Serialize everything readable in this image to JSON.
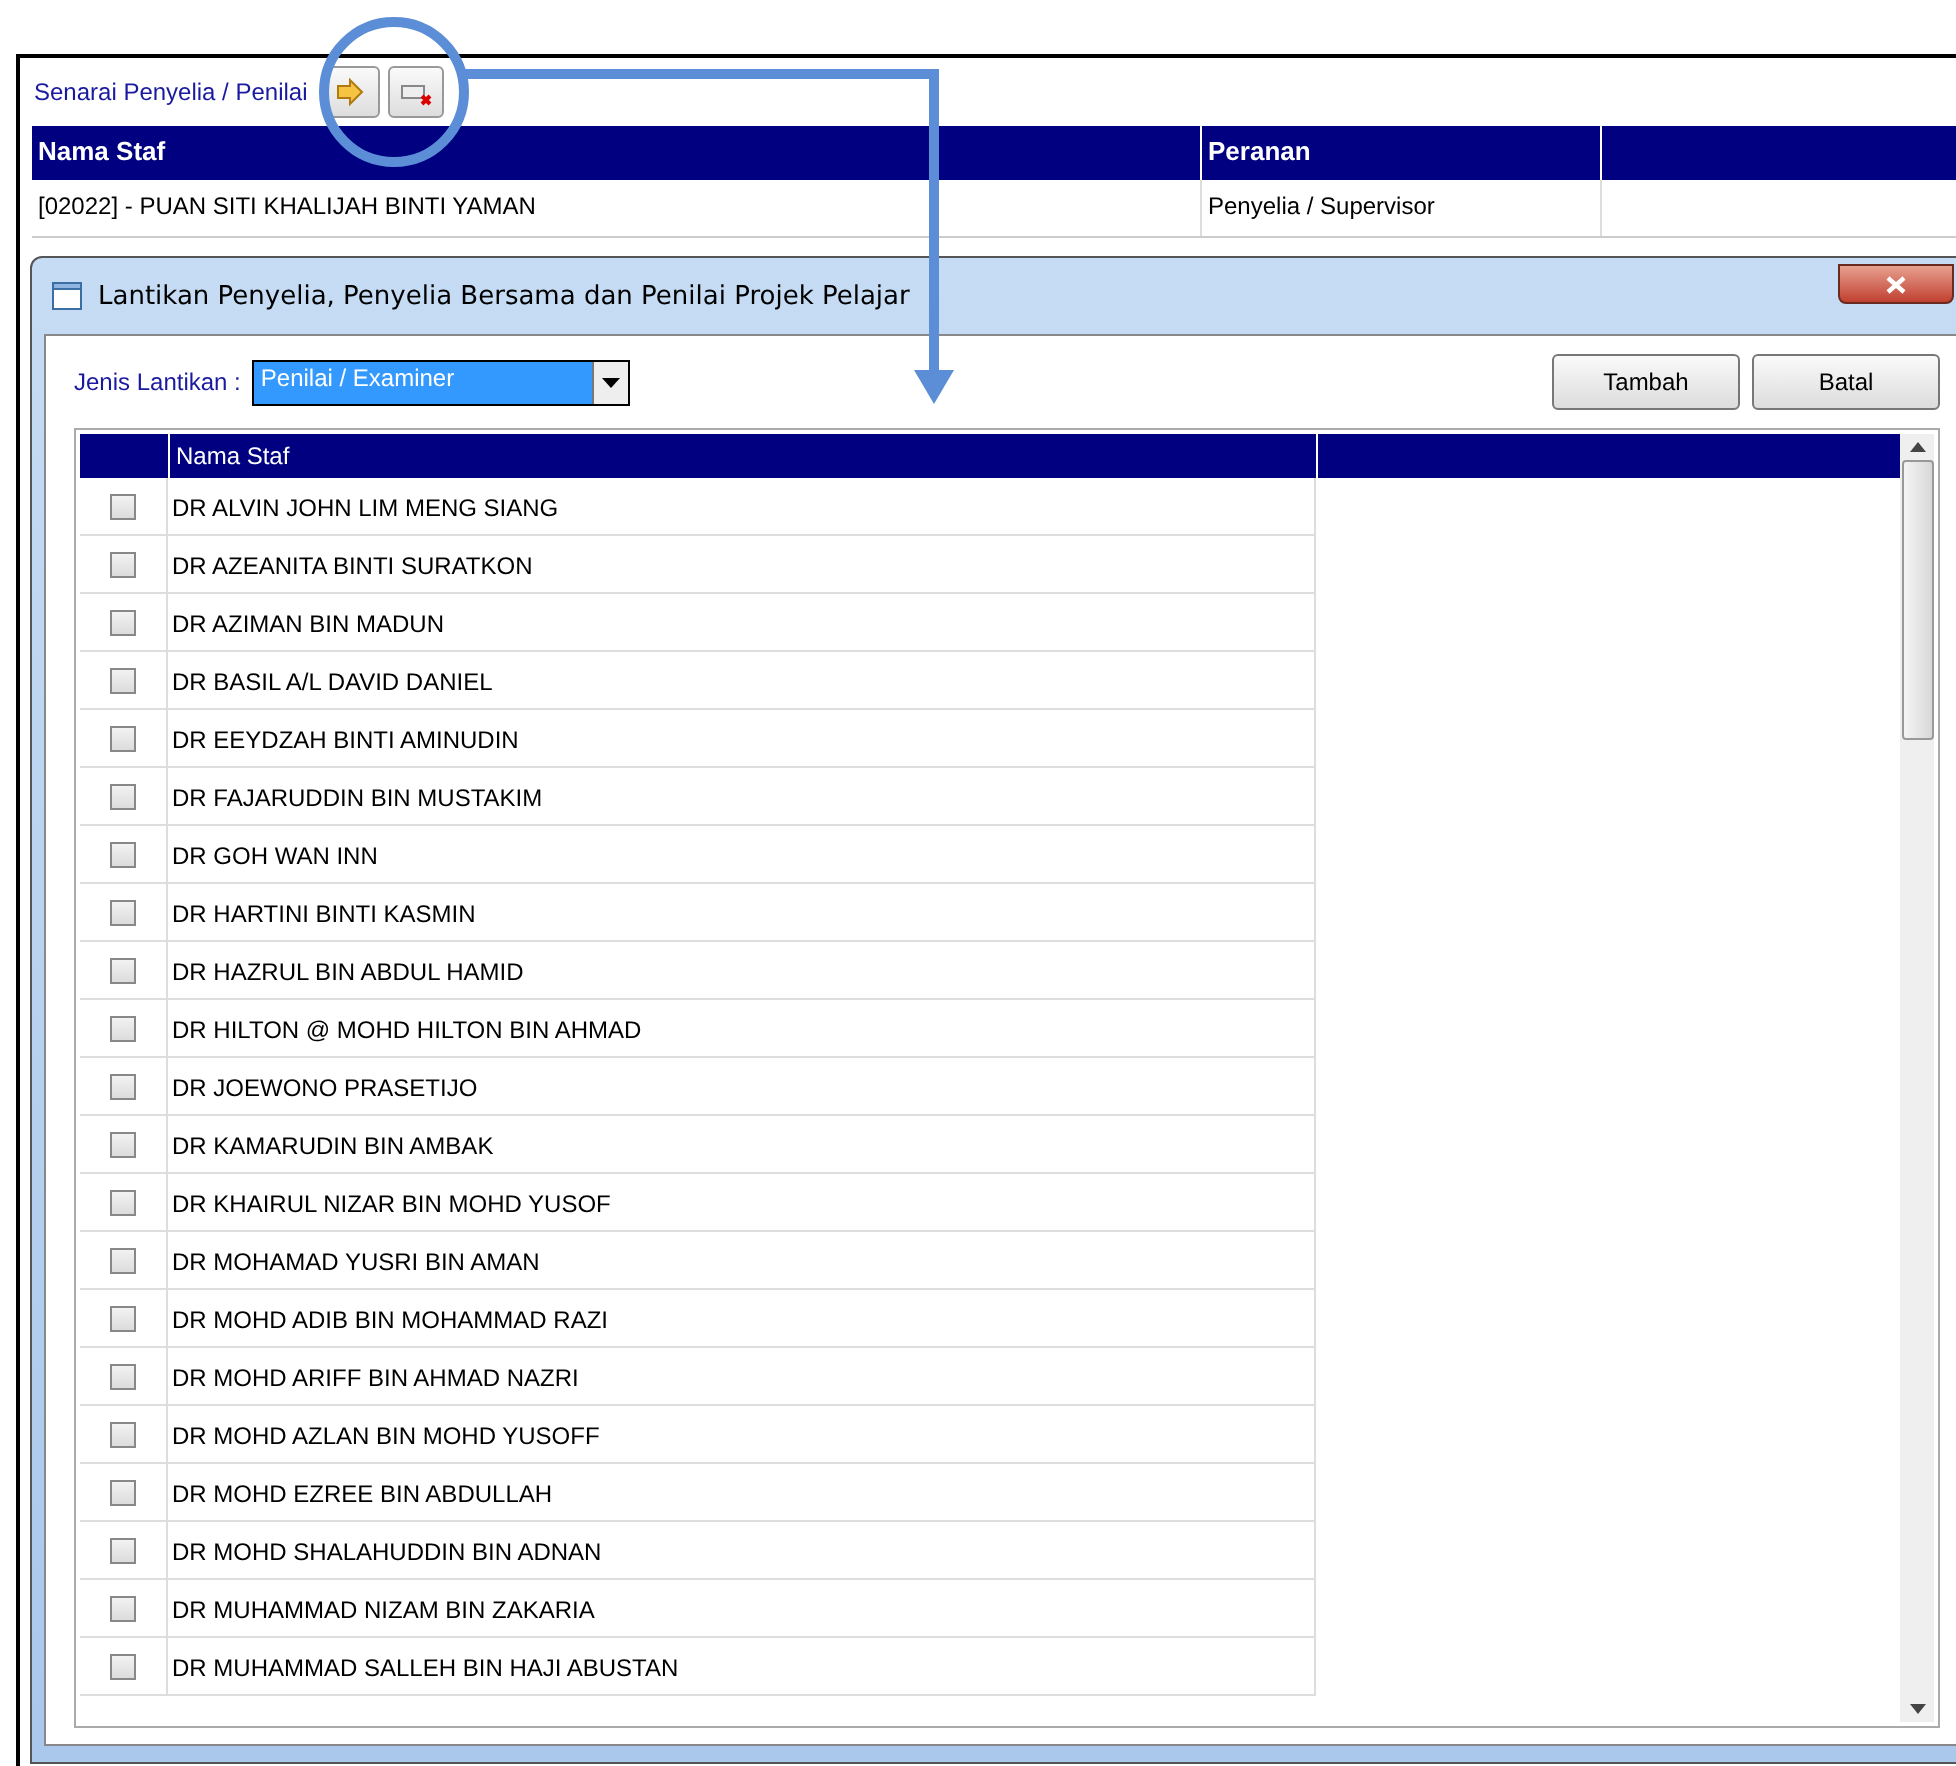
{
  "background": {
    "title": "Senarai Penyelia / Penilai",
    "columns": [
      "Nama Staf",
      "Peranan"
    ],
    "rows": [
      [
        "[02022] - PUAN SITI KHALIJAH BINTI YAMAN",
        "Penyelia / Supervisor"
      ]
    ]
  },
  "dialog": {
    "title": "Lantikan Penyelia, Penyelia Bersama dan Penilai Projek Pelajar",
    "jenis_label": "Jenis Lantikan :",
    "jenis_value": "Penilai / Examiner",
    "buttons": [
      "Tambah",
      "Batal"
    ],
    "column": "Nama Staf",
    "rows": [
      {
        "name": "DR ALVIN JOHN LIM MENG SIANG",
        "checked": false
      },
      {
        "name": "DR AZEANITA BINTI SURATKON",
        "checked": false
      },
      {
        "name": "DR AZIMAN BIN MADUN",
        "checked": false
      },
      {
        "name": "DR BASIL A/L DAVID DANIEL",
        "checked": false
      },
      {
        "name": "DR EEYDZAH BINTI AMINUDIN",
        "checked": false
      },
      {
        "name": "DR FAJARUDDIN BIN MUSTAKIM",
        "checked": false
      },
      {
        "name": "DR GOH WAN INN",
        "checked": false
      },
      {
        "name": "DR HARTINI BINTI KASMIN",
        "checked": false
      },
      {
        "name": "DR HAZRUL BIN ABDUL HAMID",
        "checked": false
      },
      {
        "name": "DR HILTON @ MOHD HILTON BIN AHMAD",
        "checked": false
      },
      {
        "name": "DR JOEWONO PRASETIJO",
        "checked": false
      },
      {
        "name": "DR KAMARUDIN BIN AMBAK",
        "checked": false
      },
      {
        "name": "DR KHAIRUL NIZAR BIN MOHD YUSOF",
        "checked": false
      },
      {
        "name": "DR MOHAMAD YUSRI BIN AMAN",
        "checked": false
      },
      {
        "name": "DR MOHD ADIB BIN MOHAMMAD RAZI",
        "checked": false
      },
      {
        "name": "DR MOHD ARIFF BIN AHMAD NAZRI",
        "checked": false
      },
      {
        "name": "DR MOHD AZLAN BIN MOHD YUSOFF",
        "checked": false
      },
      {
        "name": "DR MOHD EZREE BIN ABDULLAH",
        "checked": false
      },
      {
        "name": "DR MOHD SHALAHUDDIN BIN ADNAN",
        "checked": false
      },
      {
        "name": "DR MUHAMMAD NIZAM BIN ZAKARIA",
        "checked": false
      },
      {
        "name": "DR MUHAMMAD SALLEH BIN HAJI ABUSTAN",
        "checked": false
      }
    ]
  }
}
